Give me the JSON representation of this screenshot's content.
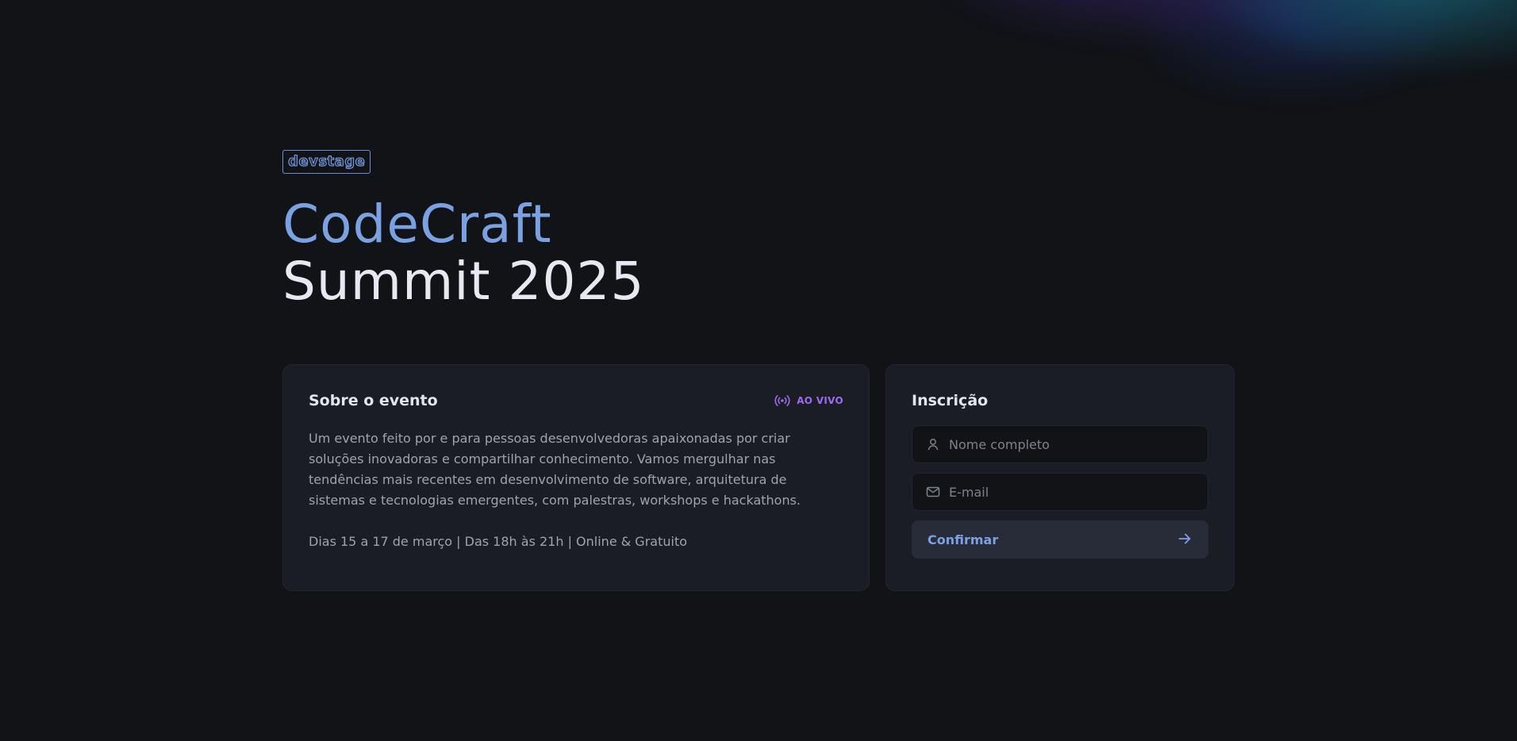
{
  "brand": {
    "logo_text": "devstage"
  },
  "hero": {
    "title_line1": "CodeCraft",
    "title_line2": "Summit 2025"
  },
  "about": {
    "title": "Sobre o evento",
    "live_label": "AO VIVO",
    "live_icon": "radio-broadcast-icon",
    "description": "Um evento feito por e para pessoas desenvolvedoras apaixonadas por criar soluções inovadoras e compartilhar conhecimento. Vamos mergulhar nas tendências mais recentes em desenvolvimento de software, arquitetura de sistemas e tecnologias emergentes, com palestras, workshops e hackathons.",
    "details": "Dias 15 a 17 de março | Das 18h às 21h | Online & Gratuito"
  },
  "signup": {
    "title": "Inscrição",
    "name_field": {
      "placeholder": "Nome completo",
      "value": "",
      "icon": "user-icon"
    },
    "email_field": {
      "placeholder": "E-mail",
      "value": "",
      "icon": "mail-icon"
    },
    "submit_label": "Confirmar",
    "submit_icon": "arrow-right-icon"
  },
  "colors": {
    "background": "#111317",
    "card": "#1a1d23",
    "accent_blue": "#7aa2e3",
    "accent_purple": "#9a6cf2",
    "title_white": "#e6e9f2"
  }
}
